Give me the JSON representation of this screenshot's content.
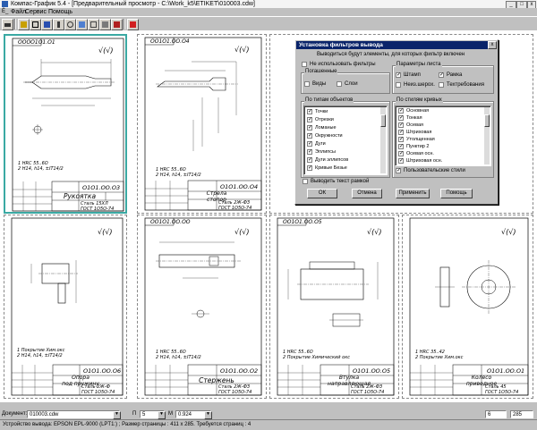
{
  "window": {
    "title": "Компас-График 5.4 - [Предварительный просмотр - C:\\Work_k5\\ETIKET\\010003.cdw]",
    "min": "_",
    "max": "□",
    "close": "x"
  },
  "menu": [
    "Файл",
    "Сервис",
    "Помощь"
  ],
  "toolbar": {
    "buttons": [
      "print-icon",
      "open-icon",
      "fit-icon",
      "scale-icon",
      "move-icon",
      "rotate-icon",
      "sheets-icon",
      "grid-icon",
      "settings-icon",
      "layout-icon",
      "close-preview-icon"
    ]
  },
  "sheets": [
    {
      "top_code": "ОООО1О1.О1",
      "roughness": "√(√)",
      "code": "О1О1.ОО.О3",
      "name": "Рукоятка",
      "material": "Сталь 15ХЛ\nГОСТ 1О5О-74",
      "notes": "1 НRC 55..6О\n2 Н14, h14, ±IT14/2",
      "selected": true
    },
    {
      "top_code": "ОО1О1.ОО.О4",
      "roughness": "√(√)",
      "code": "О1О1.ОО.О4",
      "name": "Стрела\nстопор",
      "material": "Сталь 2Ж-ФЗ\nГОСТ 1О5О-74",
      "notes": "1 НRC 55..6О\n2 Н14, h14, ±IT14/2",
      "selected": false
    },
    {
      "top_code": "",
      "roughness": "√(√)",
      "code": "О1О1.ОО.О6",
      "name": "Опора\nпод пружину",
      "material": "Сталь 2Ж-Ф\nГОСТ 1О5О-74",
      "notes": "1 Покрытие Хим.окс\n2 Н14, h14, ±IT14/2",
      "selected": false
    },
    {
      "top_code": "ОО1О1.ОО.ОО",
      "roughness": "√(√)",
      "code": "О1О1.ОО.О2",
      "name": "Стержень",
      "material": "Сталь 2Ж-ФЗ\nГОСТ 1О5О-74",
      "notes": "1 НRC 55..6О\n2 Н14, h14, ±IT14/2",
      "selected": false
    },
    {
      "top_code": "ОО1О1.ОО.О5",
      "roughness": "√(√)",
      "code": "О1О1.ОО.О5",
      "name": "Втулка\nнаправляющая",
      "material": "Сталь 2Ж-ФЗ\nГОСТ 1О5О-74",
      "notes": "1 НRC 55..6О\n2 Покрытие Химический окс",
      "selected": false
    },
    {
      "top_code": "",
      "roughness": "√(√)",
      "code": "О1О1.ОО.О1",
      "name": "Колесо\nприводное",
      "material": "Сталь 45\nГОСТ 1О5О-74",
      "notes": "1 НRC 35..42\n2 Покрытие Хим.окс",
      "selected": false
    }
  ],
  "dialog": {
    "title": "Установка фильтров вывода",
    "intro": "Выводиться будут элементы, для которых фильтр включен",
    "no_filters": {
      "label": "Не использовать фильтры",
      "checked": false
    },
    "layers": {
      "label": "Погашенные",
      "items": [
        {
          "label": "Виды",
          "checked": false
        },
        {
          "label": "Слои",
          "checked": false
        }
      ]
    },
    "sheet_params": {
      "label": "Параметры листа",
      "items": [
        {
          "label": "Штамп",
          "checked": true
        },
        {
          "label": "Рамка",
          "checked": true
        },
        {
          "label": "Неиз.шерох.",
          "checked": false
        },
        {
          "label": "Техтребования",
          "checked": false
        }
      ]
    },
    "object_types": {
      "label": "По типам объектов",
      "items": [
        "Точки",
        "Отрезки",
        "Ломаные",
        "Окружности",
        "Дуги",
        "Эллипсы",
        "Дуги эллипсов",
        "Кривые Безье"
      ]
    },
    "line_styles": {
      "label": "По стилям кривых",
      "items": [
        "Основная",
        "Тонкая",
        "Осевая",
        "Штриховая",
        "Утолщенная",
        "Пунктир 2",
        "Осевая осн.",
        "Штриховая осн."
      ]
    },
    "print_frame_text": {
      "label": "Выводить текст рамкой",
      "checked": false
    },
    "user_styles": {
      "label": "Пользовательские стили",
      "checked": true
    },
    "buttons": {
      "ok": "ОК",
      "cancel": "Отмена",
      "apply": "Применить",
      "help": "Помощь"
    }
  },
  "docbar": {
    "doc_label": "Документ:",
    "doc_value": "010003.cdw",
    "page_label": "П",
    "page_value": "5",
    "zoom_label": "М",
    "zoom_value": "0.924",
    "copies_value": "6",
    "extra_value": "285"
  },
  "status": {
    "text": "Устройство вывода: EPSON EPL-9000 (LPT1:) ; Размер страницы : 411 x 285. Требуется страниц : 4"
  }
}
